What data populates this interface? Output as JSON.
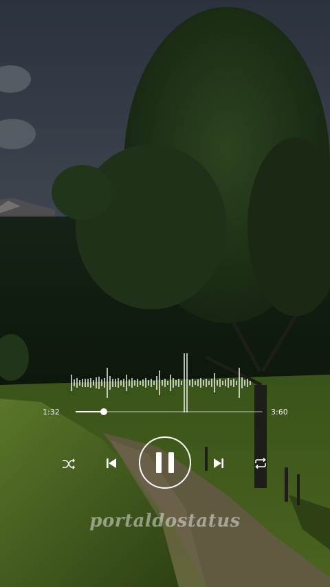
{
  "player": {
    "current_time": "1:32",
    "total_time": "3:60",
    "progress": 0.15
  },
  "controls": {
    "shuffle_icon": "shuffle-icon",
    "previous_icon": "skip-previous-icon",
    "play_pause_icon": "pause-icon",
    "next_icon": "skip-next-icon",
    "repeat_icon": "repeat-icon"
  },
  "watermark": {
    "text": "portaldostatus"
  },
  "colors": {
    "controls": "#ffffff",
    "sky": "#4a5566",
    "foliage": "#2f4a25",
    "grass": "#5f7f2a"
  }
}
